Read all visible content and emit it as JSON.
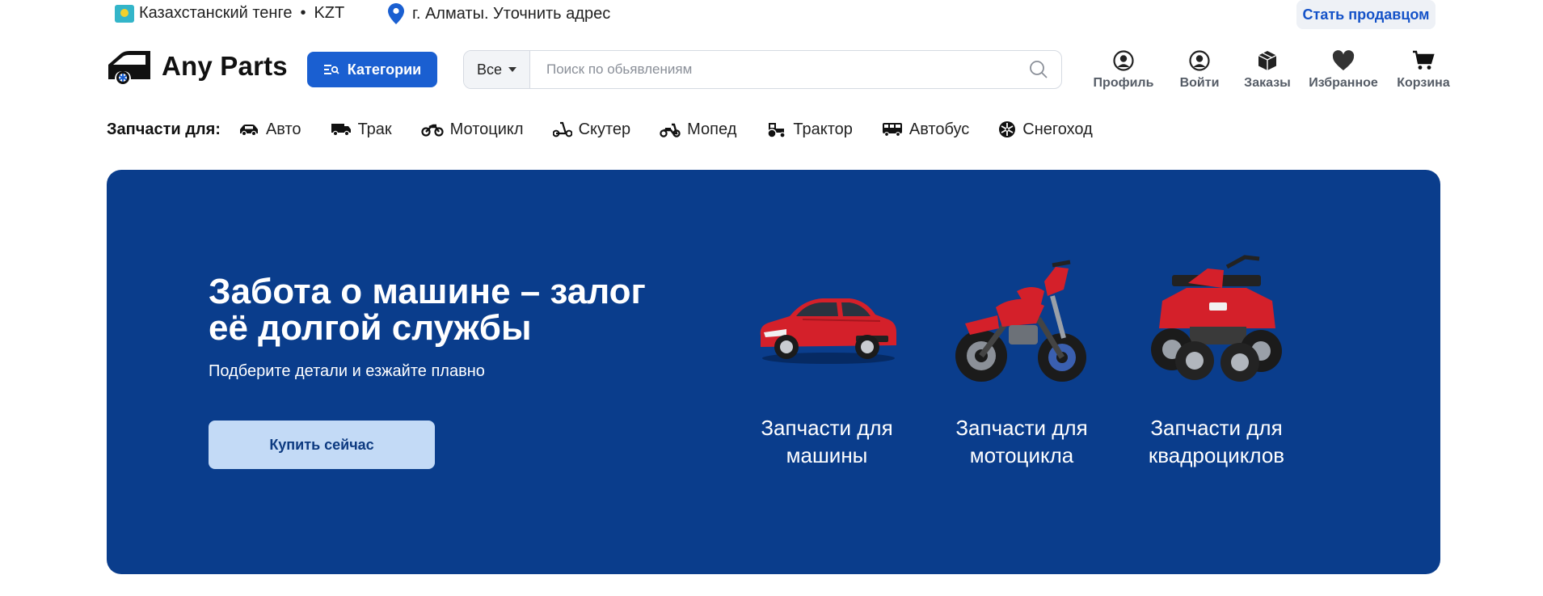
{
  "topbar": {
    "currency": "Казахстанский тенге",
    "currency_code": "KZT",
    "location": "г. Алматы. Уточнить адрес",
    "seller_button": "Стать продавцом"
  },
  "header": {
    "logo_text": "Any Parts",
    "categories_button": "Категории",
    "search": {
      "scope": "Все",
      "placeholder": "Поиск по обьявлениям"
    },
    "actions": [
      {
        "label": "Профиль",
        "icon": "profile-icon"
      },
      {
        "label": "Войти",
        "icon": "login-icon"
      },
      {
        "label": "Заказы",
        "icon": "orders-icon"
      },
      {
        "label": "Избранное",
        "icon": "heart-icon"
      },
      {
        "label": "Корзина",
        "icon": "cart-icon"
      }
    ]
  },
  "parts_nav": {
    "label": "Запчасти для:",
    "items": [
      {
        "label": "Авто",
        "icon": "car-icon"
      },
      {
        "label": "Трак",
        "icon": "truck-icon"
      },
      {
        "label": "Мотоцикл",
        "icon": "motorcycle-icon"
      },
      {
        "label": "Скутер",
        "icon": "scooter-icon"
      },
      {
        "label": "Мопед",
        "icon": "moped-icon"
      },
      {
        "label": "Трактор",
        "icon": "tractor-icon"
      },
      {
        "label": "Автобус",
        "icon": "bus-icon"
      },
      {
        "label": "Снегоход",
        "icon": "snowmobile-icon"
      }
    ]
  },
  "hero": {
    "title": "Забота о машине – залог её долгой службы",
    "subtitle": "Подберите детали и езжайте плавно",
    "cta": "Купить сейчас",
    "vehicles": [
      {
        "label": "Запчасти для машины",
        "icon": "red-car-image"
      },
      {
        "label": "Запчасти для мотоцикла",
        "icon": "red-motorcycle-image"
      },
      {
        "label": "Запчасти для квадроциклов",
        "icon": "red-atv-image"
      }
    ]
  },
  "colors": {
    "primary": "#1a5fd1",
    "hero_bg": "#0a3d8c",
    "cta_bg": "#c3daf6",
    "vehicle_red": "#d4202a"
  }
}
